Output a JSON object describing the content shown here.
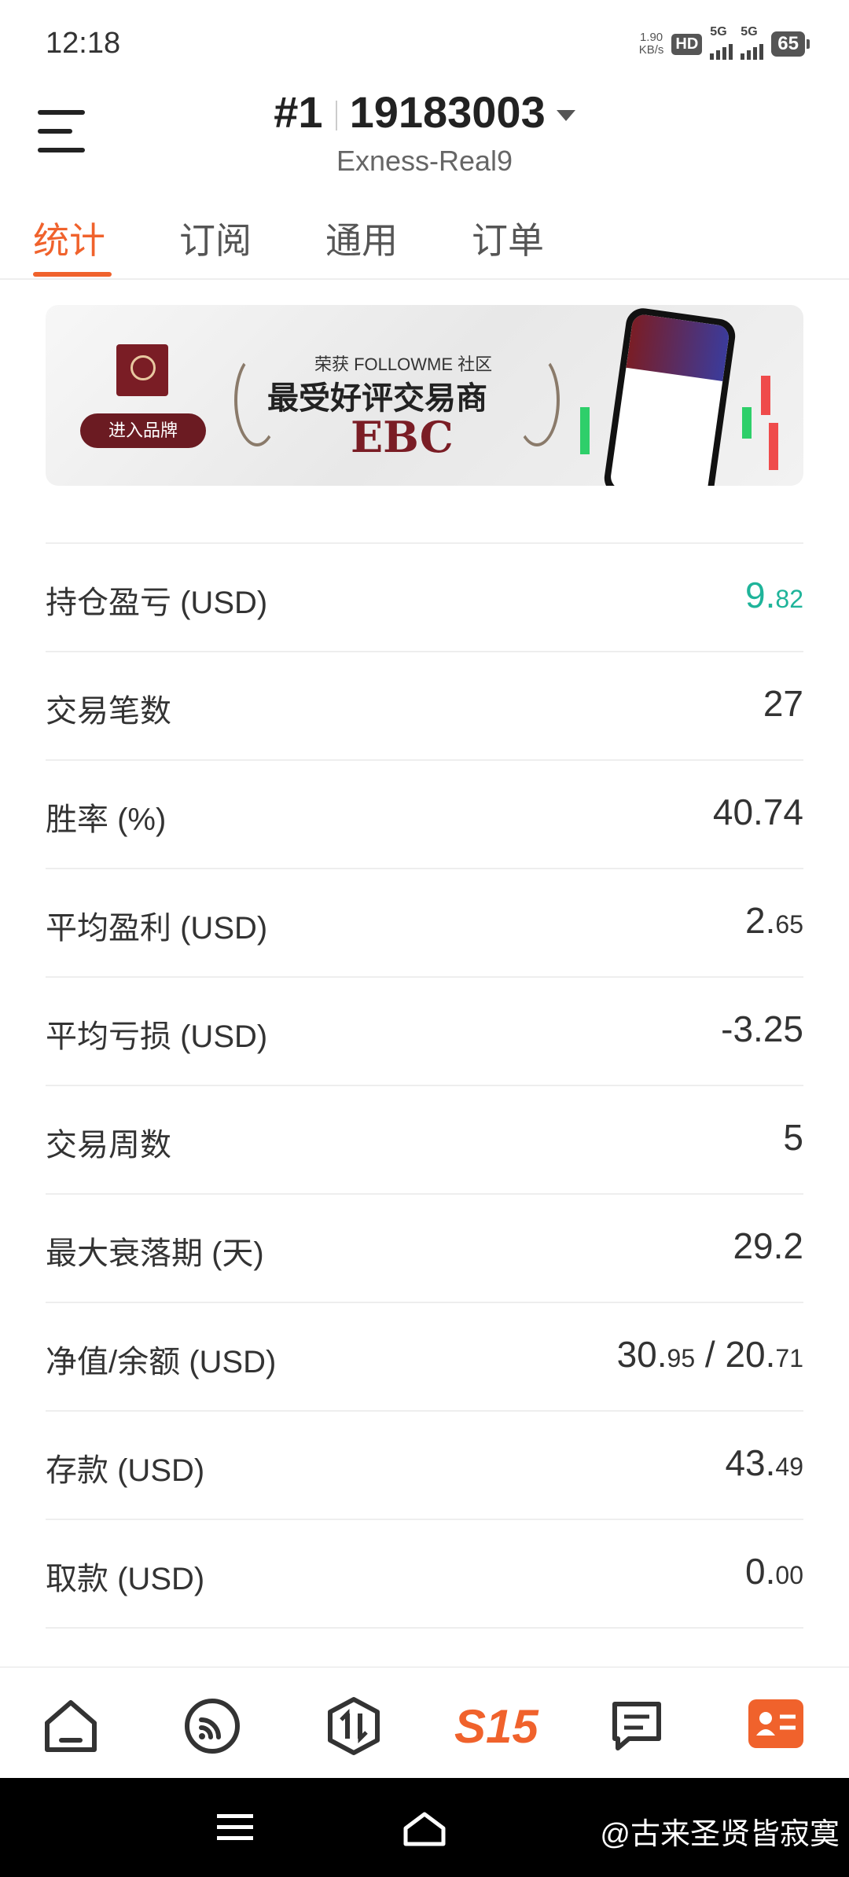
{
  "status_bar": {
    "time": "12:18",
    "net_speed_value": "1.90",
    "net_speed_unit": "KB/s",
    "hd_label": "HD",
    "sim1_network": "5G",
    "sim2_network": "5G",
    "battery": "65"
  },
  "header": {
    "account_number": "#1",
    "account_id": "19183003",
    "server": "Exness-Real9"
  },
  "tabs": [
    "统计",
    "订阅",
    "通用",
    "订单"
  ],
  "active_tab": 0,
  "banner": {
    "button": "进入品牌",
    "subtitle": "荣获 FOLLOWME 社区",
    "headline": "最受好评交易商",
    "brand": "EBC"
  },
  "stats": [
    {
      "label": "持仓盈亏 (USD)",
      "value_int": "9.",
      "value_dec": "82",
      "color": "#1fb49a"
    },
    {
      "label": "交易笔数",
      "value_int": "27",
      "value_dec": ""
    },
    {
      "label": "胜率 (%)",
      "value_int": "40.74",
      "value_dec": ""
    },
    {
      "label": "平均盈利 (USD)",
      "value_int": "2.",
      "value_dec": "65"
    },
    {
      "label": "平均亏损 (USD)",
      "value_int": "-3.25",
      "value_dec": ""
    },
    {
      "label": "交易周数",
      "value_int": "5",
      "value_dec": ""
    },
    {
      "label": "最大衰落期 (天)",
      "value_int": "29.2",
      "value_dec": ""
    },
    {
      "label": "净值/余额 (USD)",
      "value_int": "30.",
      "value_dec": "95",
      "value_int2": " / 20.",
      "value_dec2": "71"
    },
    {
      "label": "存款 (USD)",
      "value_int": "43.",
      "value_dec": "49"
    },
    {
      "label": "取款 (USD)",
      "value_int": "0.",
      "value_dec": "00"
    }
  ],
  "bottom_nav": {
    "items": [
      "home-icon",
      "feed-icon",
      "trade-icon",
      "s15",
      "messages-icon",
      "profile-icon"
    ],
    "s15_label": "S15"
  },
  "watermark": "@古来圣贤皆寂寞"
}
